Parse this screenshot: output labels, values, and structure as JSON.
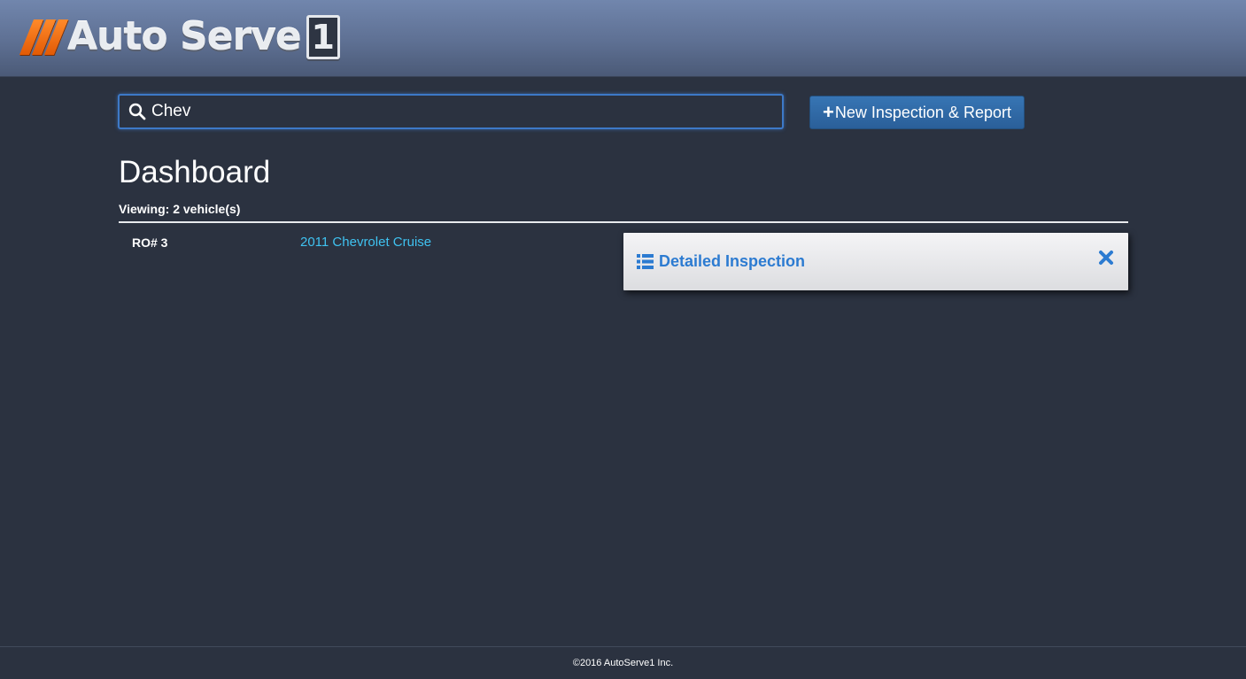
{
  "header": {
    "logo_text": "Auto Serve",
    "logo_box": "1"
  },
  "search": {
    "value": "Chev",
    "placeholder": ""
  },
  "toolbar": {
    "new_button_icon": "+",
    "new_button_label": "New Inspection & Report"
  },
  "dashboard": {
    "title": "Dashboard",
    "viewing": "Viewing: 2 vehicle(s)",
    "rows": [
      {
        "ro": "RO# 3",
        "vehicle": "2011 Chevrolet Cruise"
      }
    ]
  },
  "popup": {
    "icon": "list-icon",
    "title": "Detailed Inspection",
    "close_icon": "close-icon"
  },
  "footer": {
    "copyright": "©2016 AutoServe1 Inc."
  },
  "colors": {
    "background": "#2b3240",
    "accent": "#3775b4",
    "link": "#3fc2f0",
    "popup_title": "#2c7bd1",
    "logo_orange": "#ff8a2a"
  }
}
